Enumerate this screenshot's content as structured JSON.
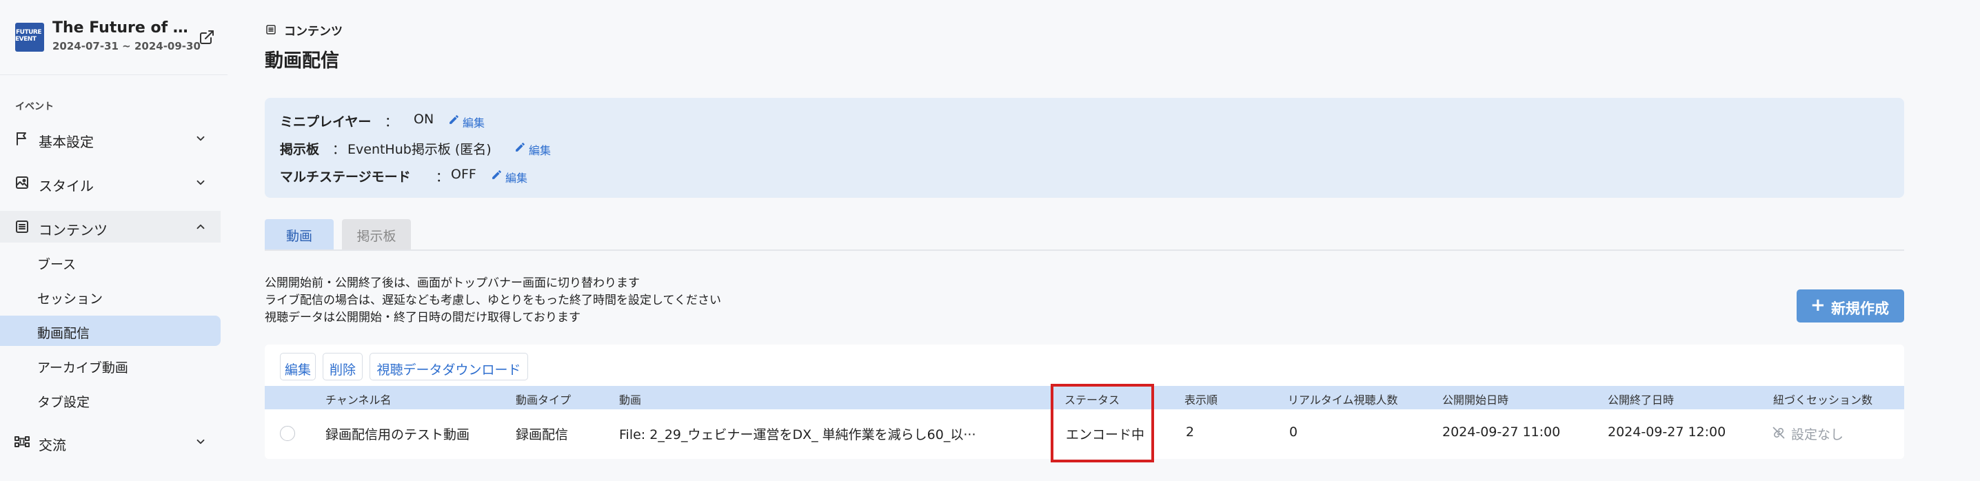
{
  "event": {
    "title": "The Future of Eve···",
    "dates": "2024-07-31 ~ 2024-09-30",
    "logo_line1": "FUTURE",
    "logo_line2": "EVENT"
  },
  "sidebar": {
    "section_label": "イベント",
    "items": [
      {
        "label": "基本設定"
      },
      {
        "label": "スタイル"
      },
      {
        "label": "コンテンツ"
      },
      {
        "label": "交流"
      }
    ],
    "content_subitems": [
      {
        "label": "ブース"
      },
      {
        "label": "セッション"
      },
      {
        "label": "動画配信"
      },
      {
        "label": "アーカイブ動画"
      },
      {
        "label": "タブ設定"
      }
    ]
  },
  "header": {
    "breadcrumb": "コンテンツ",
    "title": "動画配信"
  },
  "settings": {
    "rows": [
      {
        "key": "ミニプレイヤー",
        "sep": "：",
        "value": "ON"
      },
      {
        "key": "掲示板",
        "sep": "：",
        "value": "EventHub掲示板 (匿名)"
      },
      {
        "key": "マルチステージモード",
        "sep": "：",
        "value": "OFF"
      }
    ],
    "edit_label": "編集"
  },
  "tabs": [
    {
      "label": "動画"
    },
    {
      "label": "掲示板"
    }
  ],
  "notes": [
    "公開開始前・公開終了後は、画面がトップバナー画面に切り替わります",
    "ライブ配信の場合は、遅延なども考慮し、ゆとりをもった終了時間を設定してください",
    "視聴データは公開開始・終了日時の間だけ取得しております"
  ],
  "new_button": {
    "plus": "+",
    "label": "新規作成"
  },
  "table": {
    "actions": [
      "編集",
      "削除",
      "視聴データダウンロード"
    ],
    "columns": [
      "チャンネル名",
      "動画タイプ",
      "動画",
      "ステータス",
      "表示順",
      "リアルタイム視聴人数",
      "公開開始日時",
      "公開終了日時",
      "紐づくセッション数"
    ],
    "rows": [
      {
        "channel": "録画配信用のテスト動画",
        "type": "録画配信",
        "video": "File:   2_29_ウェビナー運営をDX_ 単純作業を減らし60_以···",
        "status": "エンコード中",
        "order": "2",
        "viewers": "0",
        "start": "2024-09-27 11:00",
        "end": "2024-09-27 12:00",
        "sessions": "設定なし"
      }
    ]
  },
  "colors": {
    "accent": "#2f6fcf",
    "selected_bg": "#cfe0f7",
    "settings_bg": "#e4edf8",
    "primary_button": "#5a96d8",
    "highlight": "#d62020"
  }
}
